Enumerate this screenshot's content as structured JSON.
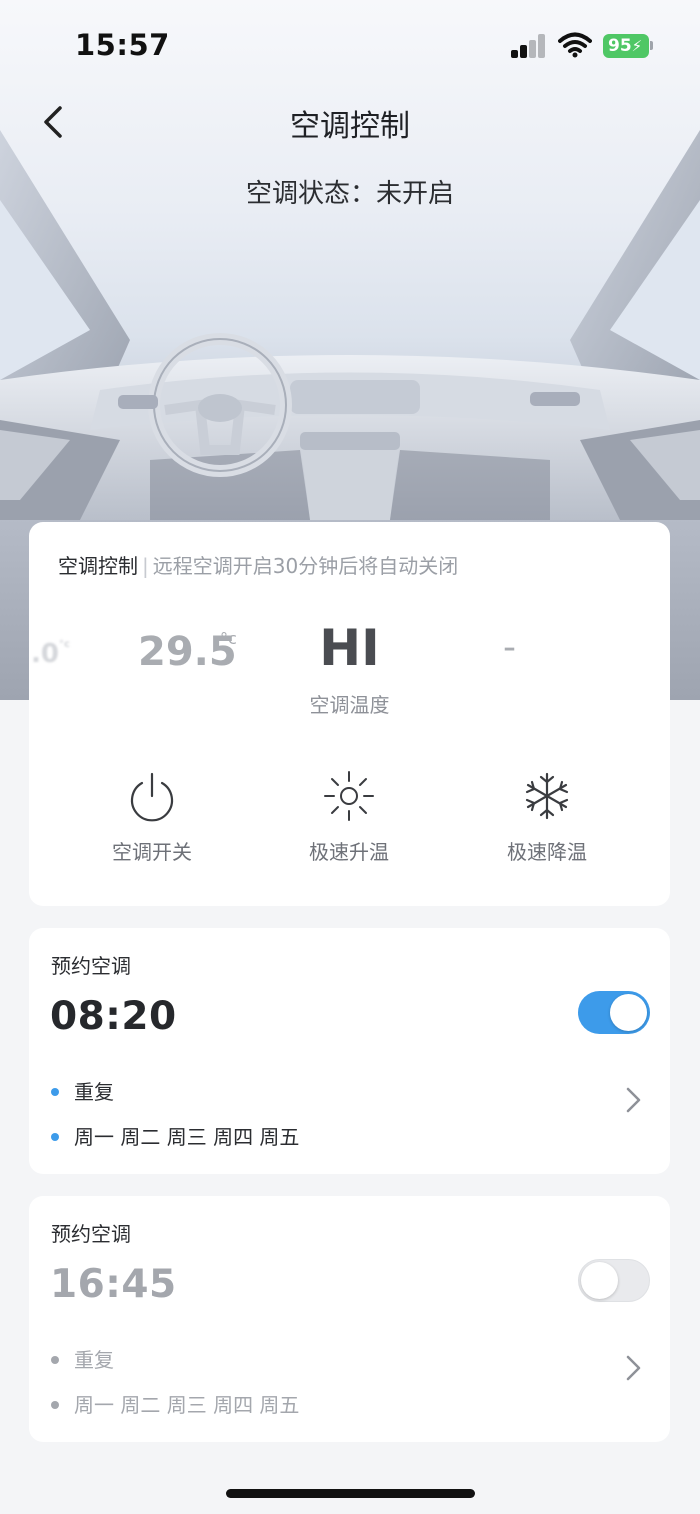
{
  "status_bar": {
    "time": "15:57",
    "battery": "95"
  },
  "header": {
    "title": "空调控制",
    "status": "空调状态：未开启"
  },
  "control": {
    "title": "空调控制",
    "separator": "|",
    "note": "远程空调开启30分钟后将自动关闭",
    "temps": {
      "far": ".0",
      "far_unit": "°c",
      "near": "29.5",
      "near_unit": "°c",
      "current": "HI",
      "next": "-"
    },
    "temp_label": "空调温度",
    "buttons": [
      {
        "label": "空调开关",
        "icon": "power-icon"
      },
      {
        "label": "极速升温",
        "icon": "sun-icon"
      },
      {
        "label": "极速降温",
        "icon": "snowflake-icon"
      }
    ]
  },
  "schedules": [
    {
      "title": "预约空调",
      "time": "08:20",
      "enabled": true,
      "repeat_label": "重复",
      "days": "周一 周二 周三 周四 周五"
    },
    {
      "title": "预约空调",
      "time": "16:45",
      "enabled": false,
      "repeat_label": "重复",
      "days": "周一 周二 周三 周四 周五"
    }
  ],
  "colors": {
    "accent": "#3d9bea",
    "battery": "#4fc765"
  }
}
